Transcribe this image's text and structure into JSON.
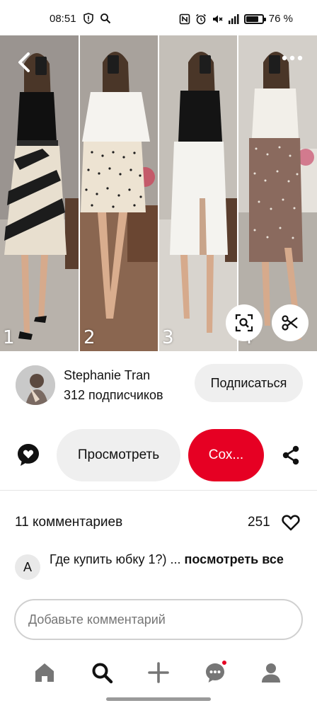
{
  "status_bar": {
    "time": "08:51",
    "battery_text": "76 %",
    "battery_level": 0.76
  },
  "pin": {
    "panel_numbers": [
      "1",
      "2",
      "3",
      "4"
    ]
  },
  "profile": {
    "name": "Stephanie Tran",
    "followers": "312 подписчиков",
    "follow_label": "Подписаться"
  },
  "actions": {
    "view_label": "Просмотреть",
    "save_label": "Сох..."
  },
  "comments": {
    "count_label": "11 комментариев",
    "likes": "251",
    "items": [
      {
        "avatar_letter": "A",
        "text": "Где купить юбку 1?) ...",
        "more": "посмотреть все"
      }
    ],
    "input_placeholder": "Добавьте комментарий"
  },
  "colors": {
    "accent": "#e60023",
    "button_gray": "#efefef"
  },
  "icons": [
    "signal-icon",
    "back-icon",
    "more-icon",
    "lens-icon",
    "scissors-icon",
    "reaction-icon",
    "share-icon",
    "heart-icon",
    "home-icon",
    "search-icon",
    "plus-icon",
    "messages-icon",
    "profile-icon"
  ]
}
